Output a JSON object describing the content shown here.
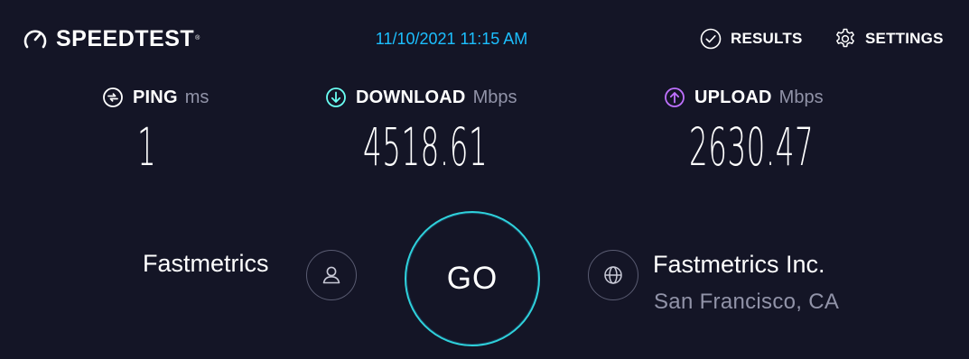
{
  "header": {
    "brand": "SPEEDTEST",
    "brand_mark": "®",
    "timestamp": "11/10/2021 11:15 AM",
    "nav": [
      {
        "label": "RESULTS",
        "icon": "check-circle-icon"
      },
      {
        "label": "SETTINGS",
        "icon": "gear-icon"
      }
    ]
  },
  "metrics": {
    "ping": {
      "label": "PING",
      "unit": "ms",
      "value": "1",
      "icon": "ping-icon"
    },
    "download": {
      "label": "DOWNLOAD",
      "unit": "Mbps",
      "value": "4518.61",
      "icon": "download-arrow-icon"
    },
    "upload": {
      "label": "UPLOAD",
      "unit": "Mbps",
      "value": "2630.47",
      "icon": "upload-arrow-icon"
    }
  },
  "provider": {
    "name": "Fastmetrics",
    "icon": "user-icon"
  },
  "go_button": {
    "label": "GO"
  },
  "server": {
    "name": "Fastmetrics Inc.",
    "location": "San Francisco, CA",
    "icon": "globe-icon"
  },
  "colors": {
    "background": "#141526",
    "accent_blue": "#1cbfff",
    "download": "#6afff3",
    "upload": "#bf71ff",
    "go_ring": "#2fd2dc",
    "muted_text": "#9193a8"
  }
}
